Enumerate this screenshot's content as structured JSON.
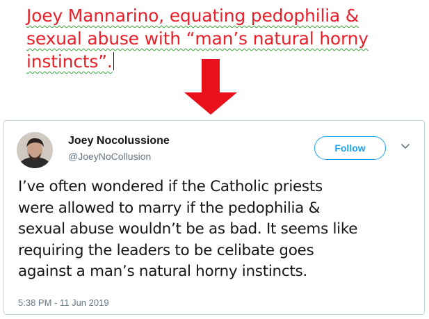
{
  "caption": {
    "lines": [
      "Joey Mannarino, equating pedophilia &",
      "sexual abuse with “man’s natural horny",
      "instincts”."
    ],
    "color": "#e8202a"
  },
  "arrow": {
    "icon": "down-arrow-icon",
    "color": "#e8101a"
  },
  "tweet": {
    "display_name": "Joey Nocolussione",
    "handle": "@JoeyNoCollusion",
    "follow_label": "Follow",
    "menu_icon": "chevron-down-icon",
    "text_lines": [
      "I’ve often wondered if the Catholic priests",
      "were allowed to marry if the pedophilia &",
      "sexual abuse wouldn’t be as bad. It seems like",
      "requiring the leaders to be celibate goes",
      "against a man’s natural horny instincts."
    ],
    "timestamp": "5:38 PM - 11 Jun 2019",
    "accent_color": "#1da1f2",
    "border_color": "#c6d7e6"
  }
}
